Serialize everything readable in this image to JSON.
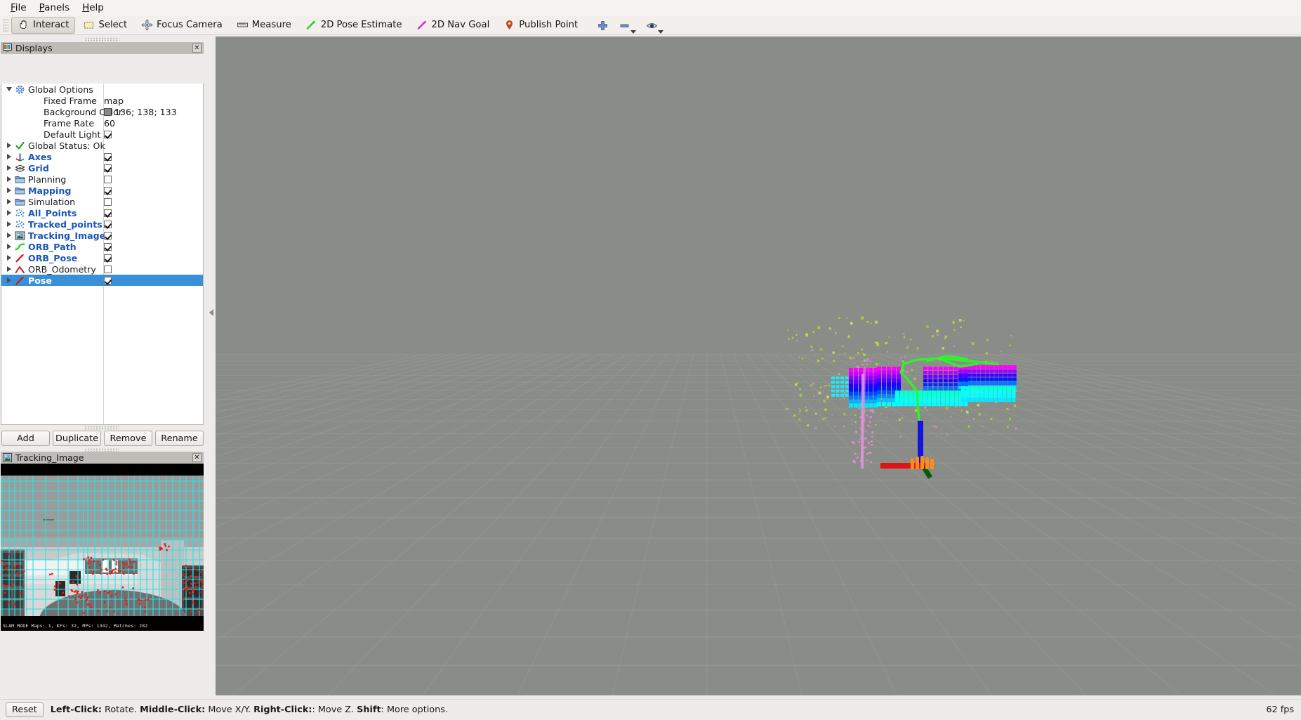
{
  "window": {
    "menu": [
      {
        "label": "File",
        "mnemonic": "F"
      },
      {
        "label": "Panels",
        "mnemonic": "P"
      },
      {
        "label": "Help",
        "mnemonic": "H"
      }
    ]
  },
  "toolbar": {
    "buttons": [
      {
        "label": "Interact",
        "icon": "hand-icon",
        "active": true
      },
      {
        "label": "Select",
        "icon": "select-rect-icon",
        "active": false
      },
      {
        "label": "Focus Camera",
        "icon": "focus-camera-icon",
        "active": false
      },
      {
        "label": "Measure",
        "icon": "ruler-icon",
        "active": false
      },
      {
        "label": "2D Pose Estimate",
        "icon": "green-arrow-icon",
        "active": false
      },
      {
        "label": "2D Nav Goal",
        "icon": "magenta-arrow-icon",
        "active": false
      },
      {
        "label": "Publish Point",
        "icon": "map-pin-icon",
        "active": false
      }
    ],
    "icon_buttons": [
      {
        "icon": "plus-icon",
        "caret": false
      },
      {
        "icon": "minus-icon",
        "caret": true
      },
      {
        "icon": "eye-icon",
        "caret": true
      }
    ]
  },
  "displays_panel": {
    "title": "Displays",
    "title_icon": "displays-icon",
    "close_label": "✕",
    "rows": [
      {
        "indent": 0,
        "twisty": "down",
        "icon": "gear-icon",
        "label": "Global Options",
        "style": "plain",
        "value_type": "none"
      },
      {
        "indent": 1,
        "twisty": "none",
        "icon": "none",
        "label": "Fixed Frame",
        "style": "plain",
        "value_type": "text",
        "value": "map"
      },
      {
        "indent": 1,
        "twisty": "none",
        "icon": "none",
        "label": "Background Color",
        "style": "plain",
        "value_type": "color",
        "value": "136; 138; 133",
        "color": "#888a85"
      },
      {
        "indent": 1,
        "twisty": "none",
        "icon": "none",
        "label": "Frame Rate",
        "style": "plain",
        "value_type": "text",
        "value": "60"
      },
      {
        "indent": 1,
        "twisty": "none",
        "icon": "none",
        "label": "Default Light",
        "style": "plain",
        "value_type": "check",
        "checked": true
      },
      {
        "indent": 0,
        "twisty": "right",
        "icon": "check-green-icon",
        "label": "Global Status: Ok",
        "style": "plain",
        "value_type": "none"
      },
      {
        "indent": 0,
        "twisty": "right",
        "icon": "axes-icon",
        "label": "Axes",
        "style": "blue",
        "value_type": "check",
        "checked": true
      },
      {
        "indent": 0,
        "twisty": "right",
        "icon": "grid-icon",
        "label": "Grid",
        "style": "blue",
        "value_type": "check",
        "checked": true
      },
      {
        "indent": 0,
        "twisty": "right",
        "icon": "folder-icon",
        "label": "Planning",
        "style": "plain",
        "value_type": "check",
        "checked": false
      },
      {
        "indent": 0,
        "twisty": "right",
        "icon": "folder-icon",
        "label": "Mapping",
        "style": "blue",
        "value_type": "check",
        "checked": true
      },
      {
        "indent": 0,
        "twisty": "right",
        "icon": "folder-icon",
        "label": "Simulation",
        "style": "plain",
        "value_type": "check",
        "checked": false
      },
      {
        "indent": 0,
        "twisty": "right",
        "icon": "pointcloud-icon",
        "label": "All_Points",
        "style": "blue",
        "value_type": "check",
        "checked": true
      },
      {
        "indent": 0,
        "twisty": "right",
        "icon": "pointcloud-icon",
        "label": "Tracked_points",
        "style": "blue",
        "value_type": "check",
        "checked": true
      },
      {
        "indent": 0,
        "twisty": "right",
        "icon": "image-icon",
        "label": "Tracking_Image",
        "style": "blue",
        "value_type": "check",
        "checked": true
      },
      {
        "indent": 0,
        "twisty": "right",
        "icon": "path-icon",
        "label": "ORB_Path",
        "style": "blue",
        "value_type": "check",
        "checked": true
      },
      {
        "indent": 0,
        "twisty": "right",
        "icon": "pose-arrow-icon",
        "label": "ORB_Pose",
        "style": "blue",
        "value_type": "check",
        "checked": true
      },
      {
        "indent": 0,
        "twisty": "right",
        "icon": "odometry-icon",
        "label": "ORB_Odometry",
        "style": "plain",
        "value_type": "check",
        "checked": false
      },
      {
        "indent": 0,
        "twisty": "right",
        "icon": "pose-arrow-icon",
        "label": "Pose",
        "style": "selected",
        "value_type": "check",
        "checked": true,
        "selected": true
      }
    ],
    "buttons": [
      {
        "label": "Add"
      },
      {
        "label": "Duplicate"
      },
      {
        "label": "Remove"
      },
      {
        "label": "Rename"
      }
    ]
  },
  "tracking_image_panel": {
    "title": "Tracking_Image",
    "title_icon": "image-icon",
    "close_label": "✕",
    "status_text": "SLAM MODE    Maps: 1, KFs: 32, MPs: 1342, Matches: 282"
  },
  "viewport": {
    "background_color": "#8a8c87",
    "grid_color": "#9d9f9a"
  },
  "statusbar": {
    "reset_label": "Reset",
    "hint_segments": [
      {
        "text": "Left-Click:",
        "bold": true
      },
      {
        "text": " Rotate. ",
        "bold": false
      },
      {
        "text": "Middle-Click:",
        "bold": true
      },
      {
        "text": " Move X/Y. ",
        "bold": false
      },
      {
        "text": "Right-Click:",
        "bold": true
      },
      {
        "text": ": Move Z. ",
        "bold": false
      },
      {
        "text": "Shift",
        "bold": true
      },
      {
        "text": ": More options.",
        "bold": false
      }
    ],
    "fps": "62 fps"
  },
  "colors": {
    "accent_blue": "#1a57b8",
    "selection_blue": "#3a8fd9",
    "panel_bg": "#edeceb",
    "title_bg": "#bfbcb7",
    "viewport_bg": "#8a8c87"
  }
}
